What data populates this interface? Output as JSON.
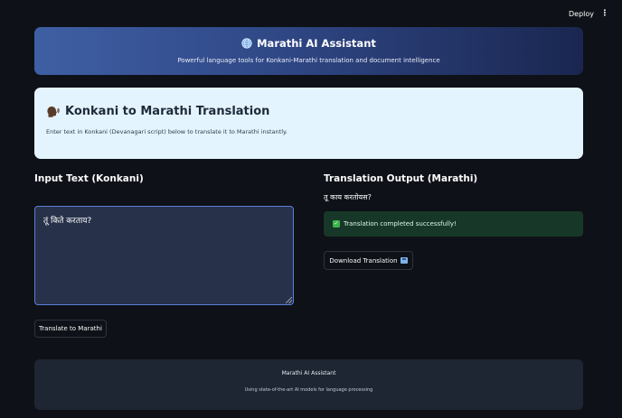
{
  "header": {
    "deploy_label": "Deploy",
    "menu_icon": "⋮"
  },
  "hero": {
    "icon": "globe-icon",
    "title": "Marathi AI Assistant",
    "subtitle": "Powerful language tools for Konkani-Marathi translation and document intelligence"
  },
  "section": {
    "icon": "speaking-head-icon",
    "title": "Konkani to Marathi Translation",
    "description": "Enter text in Konkani (Devanagari script) below to translate it to Marathi instantly."
  },
  "input": {
    "heading": "Input Text (Konkani)",
    "value": "तूं किते करताय?",
    "button_label": "Translate to Marathi"
  },
  "output": {
    "heading": "Translation Output (Marathi)",
    "text": "तू काय करतोयस?",
    "success_message": "Translation completed successfully!",
    "download_label": "Download Translation"
  },
  "footer": {
    "title": "Marathi AI Assistant",
    "subtitle": "Using state-of-the-art AI models for language processing"
  },
  "colors": {
    "background": "#0e1117",
    "hero_gradient_start": "#3f5fa4",
    "hero_gradient_end": "#1a2650",
    "card_background": "#e4f4fe",
    "success_background": "#173828",
    "input_border": "#5a7fd6"
  }
}
